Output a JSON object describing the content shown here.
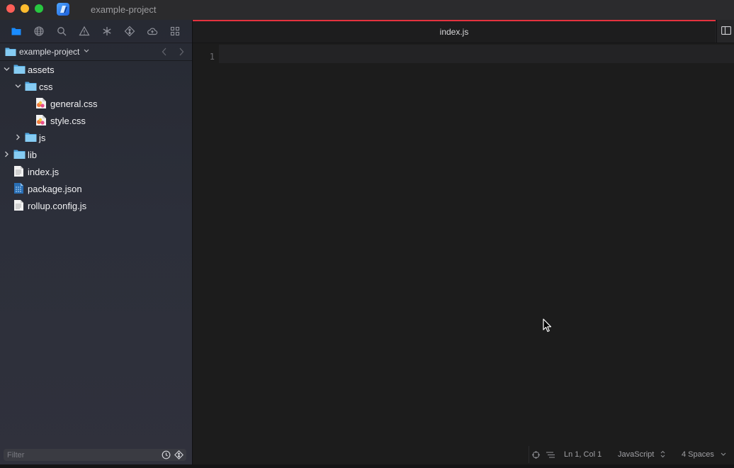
{
  "window": {
    "title": "example-project"
  },
  "sidebar": {
    "toolbar": [
      {
        "icon": "folder-icon",
        "active": true
      },
      {
        "icon": "globe-icon"
      },
      {
        "icon": "search-icon"
      },
      {
        "icon": "warning-icon"
      },
      {
        "icon": "asterisk-icon"
      },
      {
        "icon": "git-diamond-icon"
      },
      {
        "icon": "cloud-icon"
      },
      {
        "icon": "grid-icon"
      }
    ],
    "project": {
      "name": "example-project"
    },
    "tree": [
      {
        "label": "assets",
        "depth": 0,
        "type": "folder",
        "expanded": true
      },
      {
        "label": "css",
        "depth": 1,
        "type": "folder",
        "expanded": true
      },
      {
        "label": "general.css",
        "depth": 2,
        "type": "css-file"
      },
      {
        "label": "style.css",
        "depth": 2,
        "type": "css-file"
      },
      {
        "label": "js",
        "depth": 1,
        "type": "folder",
        "expanded": false
      },
      {
        "label": "lib",
        "depth": 0,
        "type": "folder",
        "expanded": false
      },
      {
        "label": "index.js",
        "depth": 0,
        "type": "text-file"
      },
      {
        "label": "package.json",
        "depth": 0,
        "type": "json-file"
      },
      {
        "label": "rollup.config.js",
        "depth": 0,
        "type": "text-file"
      }
    ],
    "filter": {
      "placeholder": "Filter",
      "value": ""
    }
  },
  "editor": {
    "tab": {
      "label": "index.js"
    },
    "lines": [
      "1"
    ],
    "status": {
      "position": "Ln 1, Col 1",
      "language": "JavaScript",
      "indentation": "4 Spaces"
    }
  },
  "colors": {
    "accent_tab": "#e5323e",
    "active_tool": "#1a8cff",
    "folder": "#5fb3e8"
  }
}
